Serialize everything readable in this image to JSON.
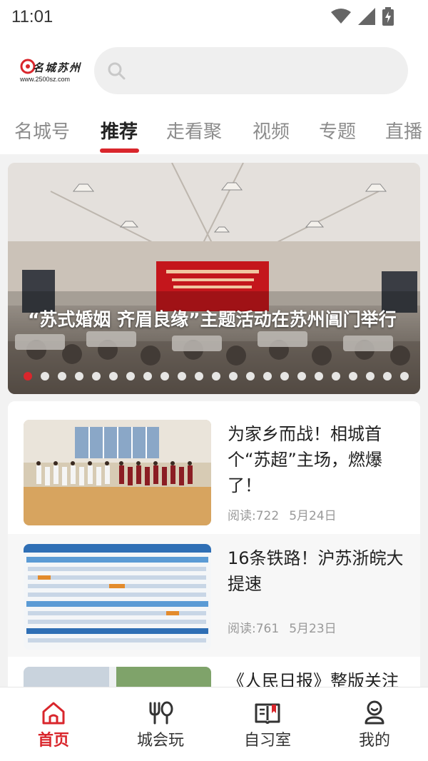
{
  "status_bar": {
    "time": "11:01"
  },
  "header": {
    "logo_name": "名城苏州",
    "logo_url": "www.2500sz.com",
    "search_placeholder": ""
  },
  "tabs": [
    {
      "label": "名城号"
    },
    {
      "label": "推荐",
      "active": true
    },
    {
      "label": "走看聚"
    },
    {
      "label": "视频"
    },
    {
      "label": "专题"
    },
    {
      "label": "直播"
    }
  ],
  "banner": {
    "title": "“苏式婚姻 齐眉良缘”主题活动在苏州阊门举行",
    "slide_count": 23,
    "active_slide": 1
  },
  "news": [
    {
      "title": "为家乡而战！相城首个“苏超”主场，燃爆了！",
      "reads_label": "阅读:722",
      "date": "5月24日"
    },
    {
      "title": "16条铁路！沪苏浙皖大提速",
      "reads_label": "阅读:761",
      "date": "5月23日"
    },
    {
      "title": "《人民日报》整版关注",
      "reads_label": "",
      "date": ""
    }
  ],
  "bottom_nav": [
    {
      "label": "首页",
      "icon": "home-icon",
      "active": true
    },
    {
      "label": "城会玩",
      "icon": "fork-spoon-icon"
    },
    {
      "label": "自习室",
      "icon": "book-icon"
    },
    {
      "label": "我的",
      "icon": "user-icon"
    }
  ],
  "colors": {
    "accent": "#d9262c",
    "background": "#f2f2f2",
    "text": "#222222",
    "muted": "#999999"
  }
}
